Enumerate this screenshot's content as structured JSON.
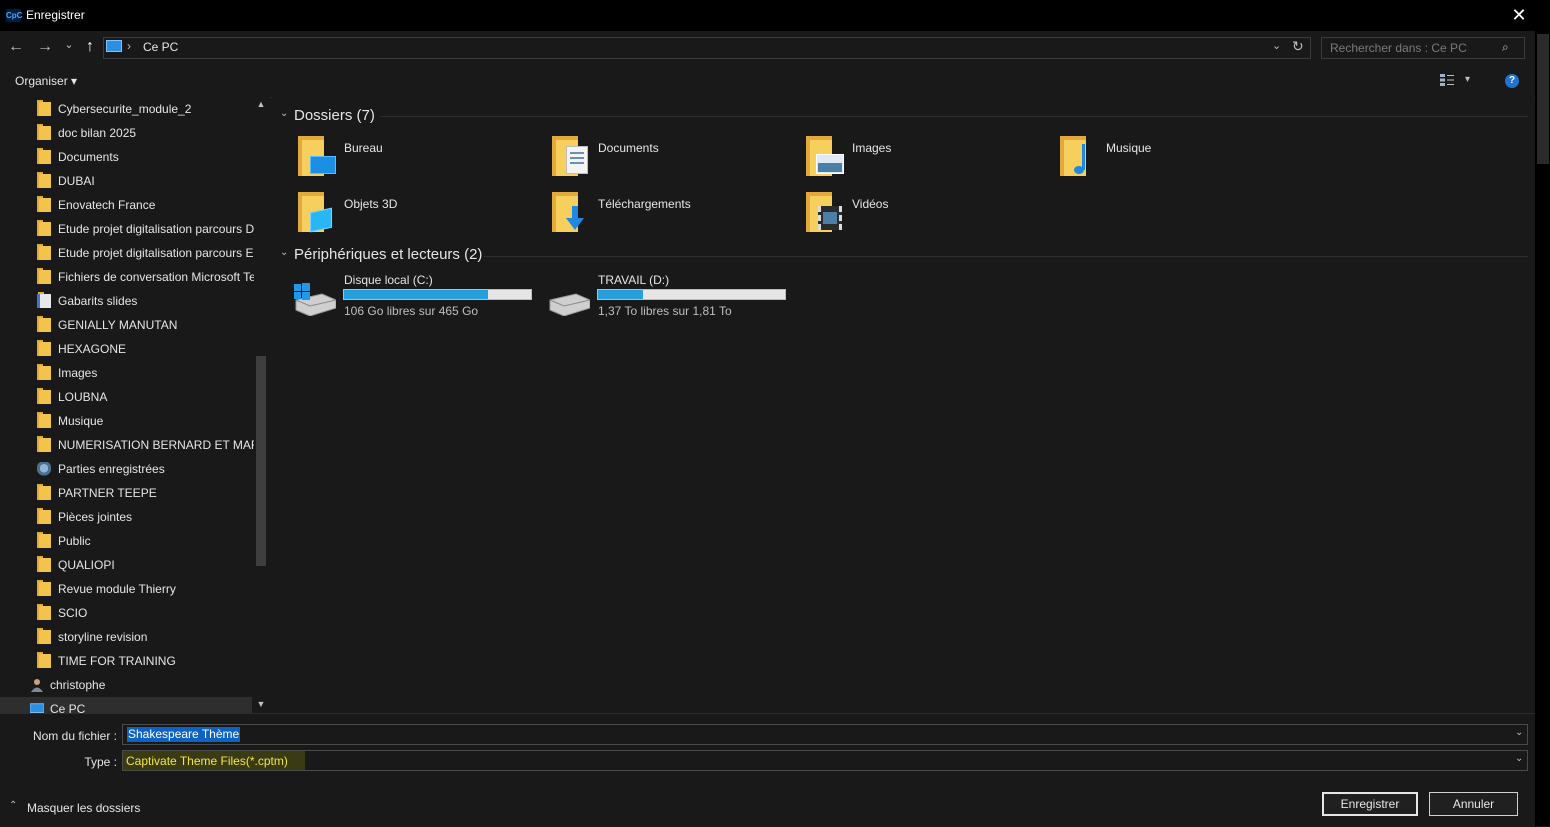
{
  "window": {
    "title": "Enregistrer",
    "app_icon_text": "CpC",
    "close_glyph": "✕"
  },
  "nav": {
    "back": "←",
    "forward": "→",
    "recent": "⌄",
    "up": "↑",
    "address": "Ce PC",
    "address_sep": "›",
    "dropdown": "⌄",
    "refresh": "↻",
    "search_placeholder": "Rechercher dans : Ce PC",
    "search_icon": "⌕"
  },
  "toolbar": {
    "organiser": "Organiser ▾",
    "view_dropdown": "▾",
    "help": "?"
  },
  "sidebar": {
    "items": [
      {
        "label": "Cybersecurite_module_2",
        "icon": "folder"
      },
      {
        "label": "doc bilan 2025",
        "icon": "folder"
      },
      {
        "label": "Documents",
        "icon": "folder"
      },
      {
        "label": "DUBAI",
        "icon": "folder"
      },
      {
        "label": "Enovatech France",
        "icon": "folder"
      },
      {
        "label": "Etude projet digitalisation parcours D",
        "icon": "folder"
      },
      {
        "label": "Etude projet digitalisation parcours E",
        "icon": "folder"
      },
      {
        "label": "Fichiers de conversation Microsoft Te",
        "icon": "folder"
      },
      {
        "label": "Gabarits slides",
        "icon": "folder-doc"
      },
      {
        "label": "GENIALLY MANUTAN",
        "icon": "folder"
      },
      {
        "label": "HEXAGONE",
        "icon": "folder"
      },
      {
        "label": "Images",
        "icon": "folder"
      },
      {
        "label": "LOUBNA",
        "icon": "folder"
      },
      {
        "label": "Musique",
        "icon": "folder"
      },
      {
        "label": "NUMERISATION BERNARD ET MARIE",
        "icon": "folder"
      },
      {
        "label": "Parties enregistrées",
        "icon": "saved-games"
      },
      {
        "label": "PARTNER TEEPE",
        "icon": "folder"
      },
      {
        "label": "Pièces jointes",
        "icon": "folder"
      },
      {
        "label": "Public",
        "icon": "folder"
      },
      {
        "label": "QUALIOPI",
        "icon": "folder"
      },
      {
        "label": "Revue module Thierry",
        "icon": "folder"
      },
      {
        "label": "SCIO",
        "icon": "folder"
      },
      {
        "label": "storyline revision",
        "icon": "folder"
      },
      {
        "label": "TIME FOR TRAINING",
        "icon": "folder"
      }
    ],
    "user": "christophe",
    "this_pc": "Ce PC",
    "scroll_up": "▲",
    "scroll_down": "▼"
  },
  "main": {
    "folders_header": "Dossiers (7)",
    "folders": [
      {
        "label": "Bureau",
        "icon": "desktop"
      },
      {
        "label": "Documents",
        "icon": "documents"
      },
      {
        "label": "Images",
        "icon": "pictures"
      },
      {
        "label": "Musique",
        "icon": "music"
      },
      {
        "label": "Objets 3D",
        "icon": "3d-objects"
      },
      {
        "label": "Téléchargements",
        "icon": "downloads"
      },
      {
        "label": "Vidéos",
        "icon": "videos"
      }
    ],
    "drives_header": "Périphériques et lecteurs (2)",
    "drives": [
      {
        "label": "Disque local (C:)",
        "free_text": "106 Go libres sur 465 Go",
        "used_fraction": 0.77,
        "icon": "windows-drive"
      },
      {
        "label": "TRAVAIL (D:)",
        "free_text": "1,37 To libres sur 1,81 To",
        "used_fraction": 0.24,
        "icon": "hard-drive"
      }
    ],
    "group_chevron": "⌄"
  },
  "footer": {
    "filename_label": "Nom du fichier :",
    "filename_value": "Shakespeare Thème",
    "type_label": "Type :",
    "type_value": "Captivate Theme Files(*.cptm)",
    "dropdown_glyph": "⌄",
    "hide_folders": "Masquer les dossiers",
    "hide_chevron": "⌃",
    "save_button": "Enregistrer",
    "cancel_button": "Annuler"
  },
  "colors": {
    "accent": "#26a0da",
    "selection": "#0d63c4",
    "folder": "#f3c34a",
    "highlight": "#f2e64b"
  }
}
